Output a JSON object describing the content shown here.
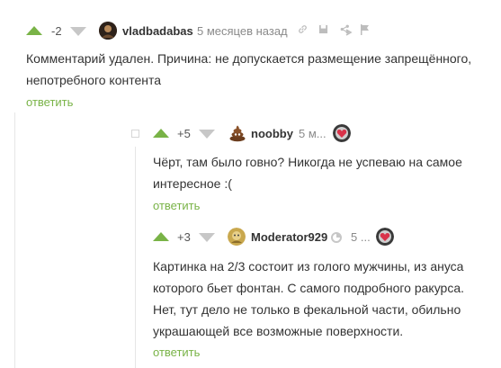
{
  "comment_1": {
    "rating": "-2",
    "author": "vladbadabas",
    "time": "5 месяцев назад",
    "text_line1": "Комментарий удален. Причина: не допускается размещение запрещённого,",
    "text_line2": "непотребного контента",
    "reply_label": "ответить"
  },
  "comment_2": {
    "rating": "+5",
    "author": "noobby",
    "time": "5 м...",
    "text_line1": "Чёрт, там было говно? Никогда не успеваю на самое",
    "text_line2": "интересное :(",
    "reply_label": "ответить"
  },
  "comment_3": {
    "rating": "+3",
    "author": "Moderator929",
    "time": "5 ...",
    "text_line1": "Картинка на 2/3 состоит из голого мужчины, из ануса",
    "text_line2": "которого бьет фонтан. С самого подробного ракурса.",
    "text_line3": "Нет, тут дело не только в фекальной части, обильно",
    "text_line4": "украшающей все возможные поверхности.",
    "reply_label": "ответить"
  },
  "colors": {
    "accent_green": "#79b347",
    "arrow_gray": "#c7c7c7",
    "thread_line": "#e6e6e6"
  },
  "icons": [
    "link-icon",
    "save-icon",
    "share-icon",
    "more-icon",
    "flag-icon",
    "poop-icon",
    "avatar-badge-icon",
    "moderator-shield-icon"
  ]
}
